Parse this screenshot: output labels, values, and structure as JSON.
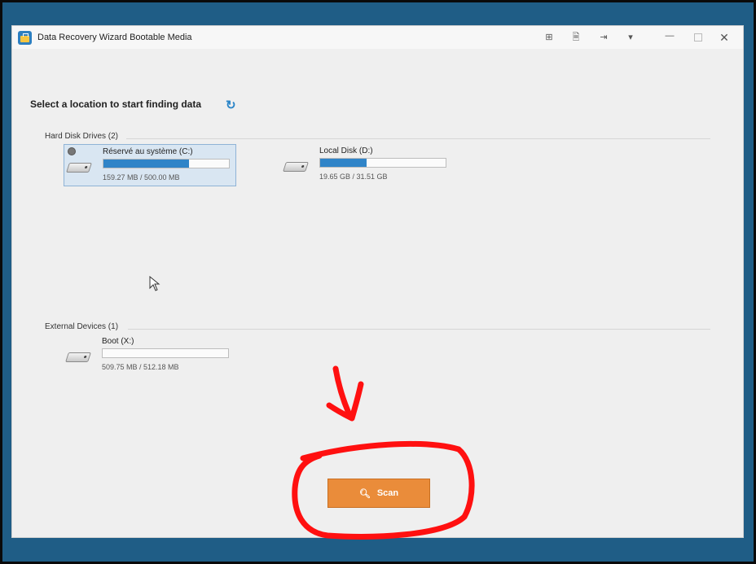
{
  "window": {
    "title": "Data Recovery Wizard Bootable Media"
  },
  "main": {
    "heading": "Select a location to start finding data",
    "sections": {
      "hard_disk": {
        "label": "Hard Disk Drives (2)",
        "drives": [
          {
            "name": "Réservé au système (C:)",
            "size": "159.27 MB / 500.00 MB",
            "used_fraction": 0.68,
            "selected": true
          },
          {
            "name": "Local Disk (D:)",
            "size": "19.65 GB / 31.51 GB",
            "used_fraction": 0.37,
            "selected": false
          }
        ]
      },
      "external": {
        "label": "External Devices (1)",
        "drives": [
          {
            "name": "Boot (X:)",
            "size": "509.75 MB / 512.18 MB",
            "used_fraction": 0.0,
            "selected": false
          }
        ]
      }
    },
    "scan_label": "Scan"
  },
  "colors": {
    "accent": "#2f84c8",
    "scan_button": "#ea8c3a",
    "annotation": "#ff1010",
    "desktop": "#1f5d86"
  }
}
